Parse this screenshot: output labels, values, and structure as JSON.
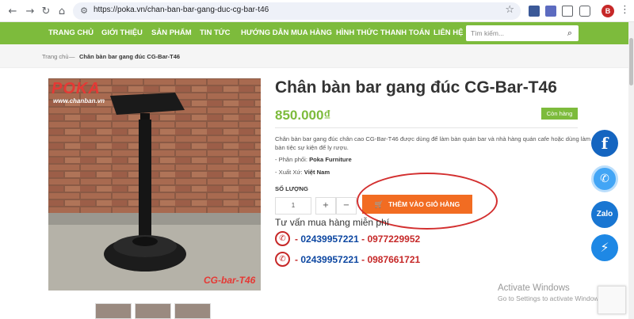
{
  "browser": {
    "url": "https://poka.vn/chan-ban-bar-gang-duc-cg-bar-t46",
    "profile_initial": "B"
  },
  "nav": {
    "items": [
      "TRANG CHỦ",
      "GIỚI THIỆU",
      "SẢN PHẨM",
      "TIN TỨC",
      "HƯỚNG DẪN MUA HÀNG",
      "HÌNH THỨC THANH TOÁN",
      "LIÊN HỆ"
    ],
    "search_placeholder": "Tìm kiếm..."
  },
  "breadcrumb": {
    "home": "Trang chủ",
    "separator": "—",
    "current": "Chân bàn bar gang đúc CG-Bar-T46"
  },
  "product": {
    "image_logo": "POKA",
    "image_site": "www.chanban.vn",
    "image_model": "CG-bar-T46",
    "title": "Chân bàn bar gang đúc CG-Bar-T46",
    "price": "850.000₫",
    "stock": "Còn hàng",
    "description": "Chân bàn bar gang đúc chân cao CG-Bar-T46 được dùng để làm bàn quán bar và nhà hàng quán cafe hoặc dùng làm bàn tiệc sự kiện để ly rượu.",
    "distributor_label": "- Phân phối:",
    "distributor_value": "Poka Furniture",
    "origin_label": "- Xuất Xứ:",
    "origin_value": "Việt Nam",
    "qty_label": "SỐ LƯỢNG",
    "qty_value": "1",
    "plus": "+",
    "minus": "−",
    "add_to_cart": "THÊM VÀO GIỎ HÀNG",
    "advice": "Tư vấn mua hàng miễn phí",
    "phones": [
      {
        "a": "02439957221",
        "b": "0977229952"
      },
      {
        "a": "02439957221",
        "b": "0987661721"
      }
    ]
  },
  "social": {
    "facebook": "f",
    "zalo": "Zalo"
  },
  "watermark": {
    "title": "Activate Windows",
    "sub": "Go to Settings to activate Windows."
  },
  "colors": {
    "nav_green": "#7dbb3c",
    "cart_orange": "#f26c22",
    "annotation_red": "#d32f2f"
  }
}
